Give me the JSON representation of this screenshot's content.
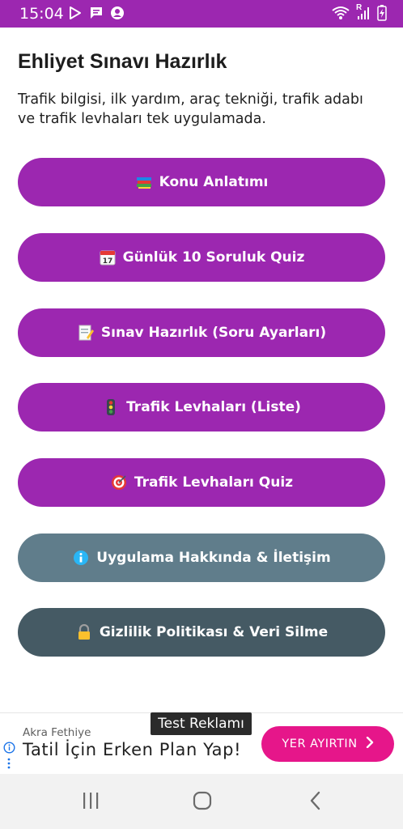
{
  "status_bar": {
    "time": "15:04",
    "icons_left": [
      "play-store-icon",
      "message-icon",
      "account-icon"
    ],
    "icons_right": [
      "wifi-icon",
      "signal-icon",
      "battery-charging-icon"
    ],
    "roaming_label": "R",
    "background": "#9c27b0"
  },
  "header": {
    "title": "Ehliyet Sınavı Hazırlık",
    "subtitle": "Trafik bilgisi, ilk yardım, araç tekniği, trafik adabı ve trafik levhaları tek uygulamada."
  },
  "menu": {
    "items": [
      {
        "label": "Konu Anlatımı",
        "icon": "books-icon",
        "color": "#9c27b0"
      },
      {
        "label": "Günlük 10 Soruluk Quiz",
        "icon": "calendar-icon",
        "color": "#9c27b0"
      },
      {
        "label": "Sınav Hazırlık (Soru Ayarları)",
        "icon": "memo-icon",
        "color": "#9c27b0"
      },
      {
        "label": "Trafik Levhaları (Liste)",
        "icon": "traffic-light-icon",
        "color": "#9c27b0"
      },
      {
        "label": "Trafik Levhaları Quiz",
        "icon": "target-icon",
        "color": "#9c27b0"
      },
      {
        "label": "Uygulama Hakkında & İletişim",
        "icon": "info-icon",
        "color": "#607d8b"
      },
      {
        "label": "Gizlilik Politikası & Veri Silme",
        "icon": "lock-icon",
        "color": "#455a64"
      }
    ]
  },
  "ad": {
    "test_label": "Test Reklamı",
    "advertiser": "Akra Fethiye",
    "headline": "Tatil İçin Erken Plan Yap!",
    "cta_label": "YER AYIRTIN",
    "cta_color": "#e6168a"
  },
  "nav_bar": {
    "buttons": [
      "recent-apps-icon",
      "home-icon",
      "back-icon"
    ]
  }
}
